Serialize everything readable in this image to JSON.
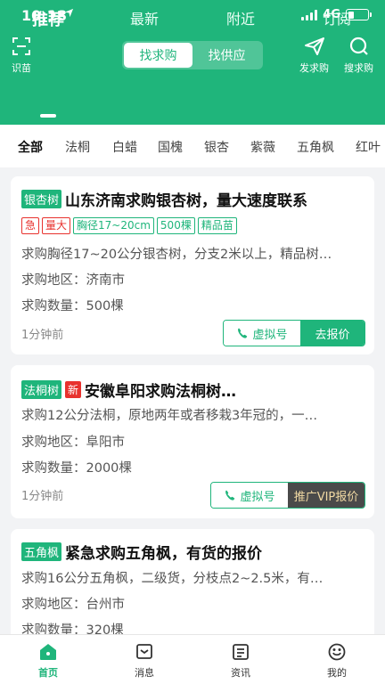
{
  "status_bar": {
    "time": "10:18",
    "location_icon": "location-arrow-icon",
    "network": "4G"
  },
  "header": {
    "scan_label": "识苗",
    "segments": [
      "找求购",
      "找供应"
    ],
    "publish_label": "发求购",
    "search_label": "搜求购",
    "tabs": [
      "推荐",
      "最新",
      "附近",
      "订阅"
    ]
  },
  "categories": [
    "全部",
    "法桐",
    "白蜡",
    "国槐",
    "银杏",
    "紫薇",
    "五角枫",
    "红叶"
  ],
  "cards": [
    {
      "tree_tag": "银杏树",
      "title": "山东济南求购银杏树，量大速度联系",
      "tags_red": [
        "急",
        "量大"
      ],
      "tags_green": [
        "胸径17~20cm",
        "500棵",
        "精品苗"
      ],
      "desc": "求购胸径17~20公分银杏树，分支2米以上，精品树…",
      "region": "求购地区：济南市",
      "quantity": "求购数量：500棵",
      "time": "1分钟前",
      "btn_left": "虚拟号",
      "btn_right": "去报价"
    },
    {
      "tree_tag": "法桐树",
      "new_tag": "新",
      "title": "安徽阜阳求购法桐树…",
      "desc": "求购12公分法桐，原地两年或者移栽3年冠的，一…",
      "region": "求购地区：阜阳市",
      "quantity": "求购数量：2000棵",
      "time": "1分钟前",
      "btn_left": "虚拟号",
      "btn_right": "推广VIP报价"
    },
    {
      "tree_tag": "五角枫",
      "title": "紧急求购五角枫，有货的报价",
      "desc": "求购16公分五角枫，二级货，分枝点2~2.5米，有…",
      "region": "求购地区：台州市",
      "quantity": "求购数量：320棵"
    }
  ],
  "bottom_nav": [
    "首页",
    "消息",
    "资讯",
    "我的"
  ],
  "colors": {
    "brand": "#1fb57b",
    "urgent": "#e8322e",
    "vip_dark": "#4a4a4a"
  }
}
